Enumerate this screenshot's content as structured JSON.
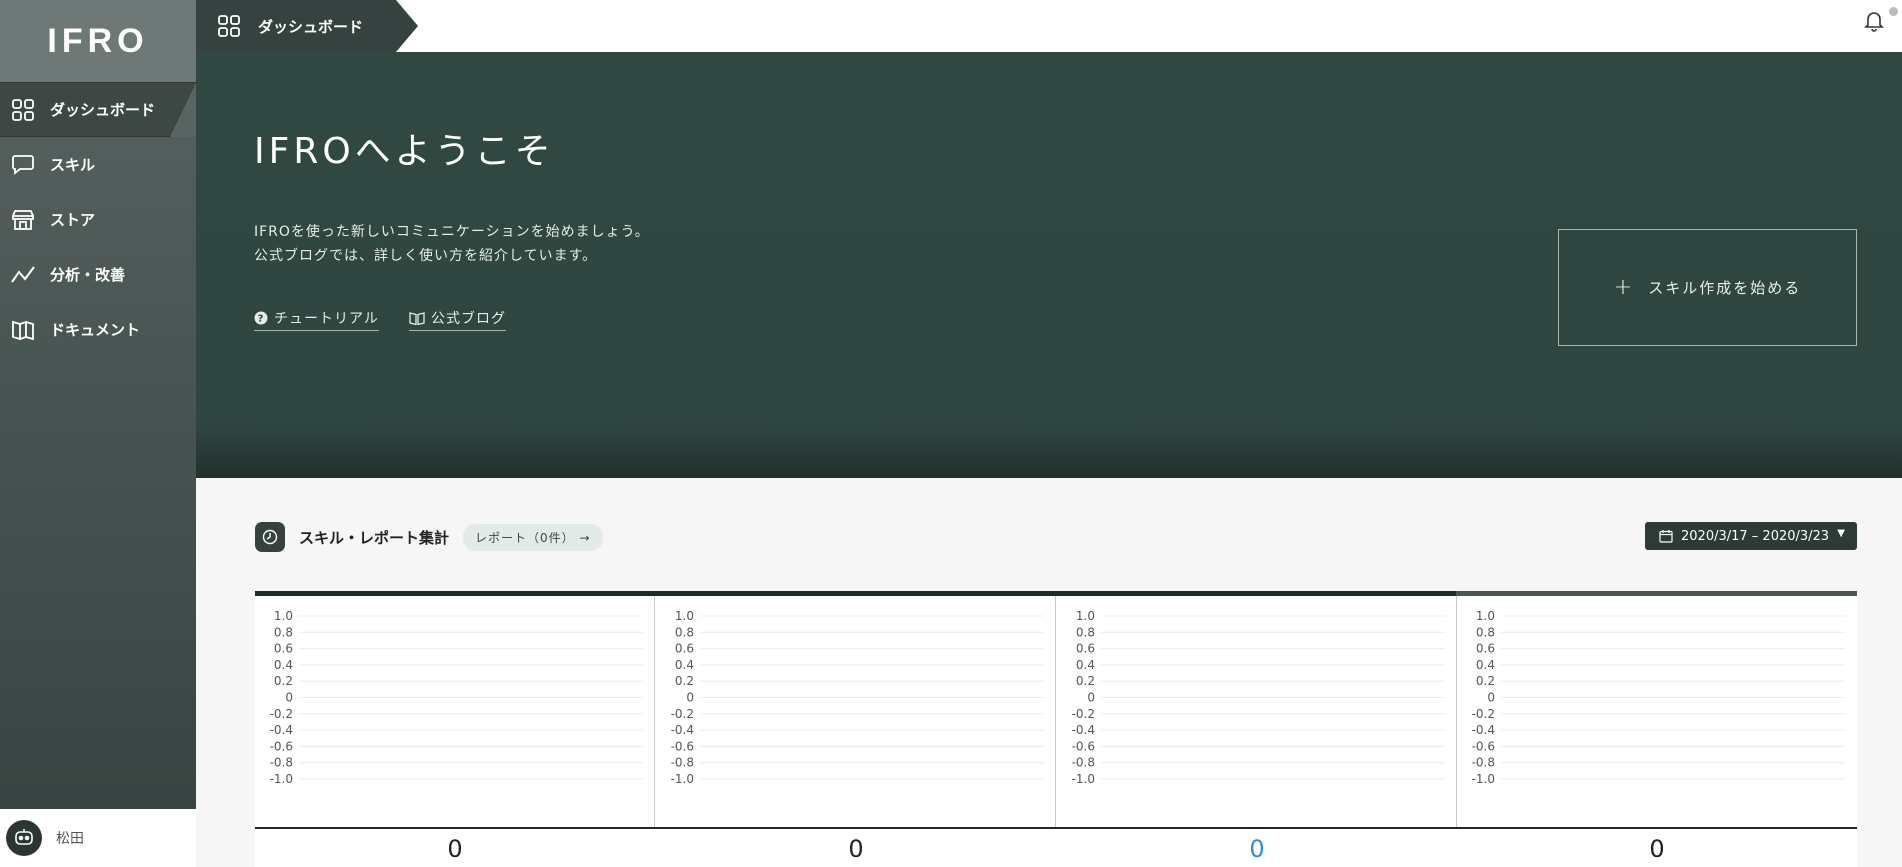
{
  "app": {
    "logo": "IFRO"
  },
  "sidebar": {
    "items": [
      {
        "label": "ダッシュボード",
        "icon": "grid-icon",
        "active": true
      },
      {
        "label": "スキル",
        "icon": "speech-bubble-icon"
      },
      {
        "label": "ストア",
        "icon": "store-icon"
      },
      {
        "label": "分析・改善",
        "icon": "chart-line-icon"
      },
      {
        "label": "ドキュメント",
        "icon": "book-icon"
      }
    ],
    "user": {
      "name": "松田",
      "avatar_icon": "robot-avatar-icon"
    }
  },
  "topbar": {
    "breadcrumb": "ダッシュボード",
    "bell_icon": "bell-icon"
  },
  "hero": {
    "title": "IFROへようこそ",
    "desc_line1": "IFROを使った新しいコミュニケーションを始めましょう。",
    "desc_line2": "公式ブログでは、詳しく使い方を紹介しています。",
    "tutorial_link": "チュートリアル",
    "blog_link": "公式ブログ",
    "start_button": "スキル作成を始める"
  },
  "report": {
    "title": "スキル・レポート集計",
    "chip": "レポート（0件） →",
    "date_range": "2020/3/17 – 2020/3/23"
  },
  "chart_data": [
    {
      "type": "line",
      "ylim": [
        -1.0,
        1.0
      ],
      "yticks": [
        "1.0",
        "0.8",
        "0.6",
        "0.4",
        "0.2",
        "0",
        "-0.2",
        "-0.4",
        "-0.6",
        "-0.8",
        "-1.0"
      ],
      "grid": true,
      "series": []
    },
    {
      "type": "line",
      "ylim": [
        -1.0,
        1.0
      ],
      "yticks": [
        "1.0",
        "0.8",
        "0.6",
        "0.4",
        "0.2",
        "0",
        "-0.2",
        "-0.4",
        "-0.6",
        "-0.8",
        "-1.0"
      ],
      "grid": true,
      "series": []
    },
    {
      "type": "line",
      "ylim": [
        -1.0,
        1.0
      ],
      "yticks": [
        "1.0",
        "0.8",
        "0.6",
        "0.4",
        "0.2",
        "0",
        "-0.2",
        "-0.4",
        "-0.6",
        "-0.8",
        "-1.0"
      ],
      "grid": true,
      "series": []
    },
    {
      "type": "line",
      "ylim": [
        -1.0,
        1.0
      ],
      "yticks": [
        "1.0",
        "0.8",
        "0.6",
        "0.4",
        "0.2",
        "0",
        "-0.2",
        "-0.4",
        "-0.6",
        "-0.8",
        "-1.0"
      ],
      "grid": true,
      "series": []
    }
  ],
  "totals": [
    "0",
    "0",
    "0",
    "0"
  ],
  "colors": {
    "accent": "#36423f",
    "highlight_total": "#2a8fe0"
  }
}
